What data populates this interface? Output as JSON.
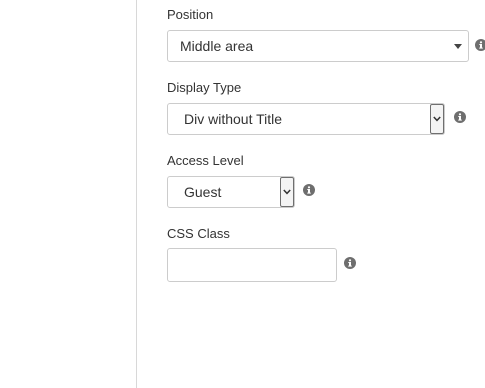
{
  "form": {
    "position": {
      "label": "Position",
      "selected": "Middle area",
      "help_icon": "info-icon"
    },
    "display_type": {
      "label": "Display Type",
      "selected": "Div without Title",
      "help_icon": "info-icon"
    },
    "access_level": {
      "label": "Access Level",
      "selected": "Guest",
      "help_icon": "info-icon"
    },
    "css_class": {
      "label": "CSS Class",
      "value": "",
      "help_icon": "info-icon"
    }
  },
  "colors": {
    "border": "#cccccc",
    "text": "#333333",
    "icon": "#6e6e6e"
  }
}
